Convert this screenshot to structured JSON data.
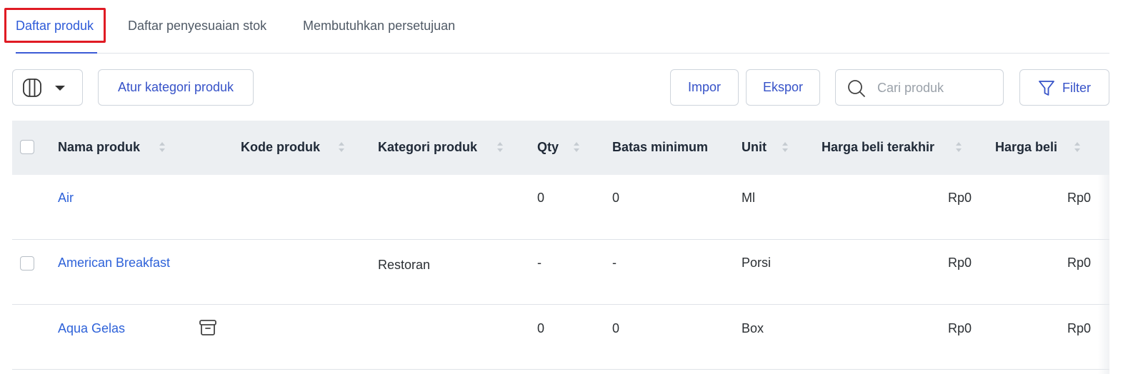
{
  "tabs": [
    {
      "label": "Daftar produk",
      "active": true
    },
    {
      "label": "Daftar penyesuaian stok",
      "active": false
    },
    {
      "label": "Membutuhkan persetujuan",
      "active": false
    }
  ],
  "toolbar": {
    "column_toggle_icon": "columns-icon",
    "dropdown_icon": "caret-down-icon",
    "category_button": "Atur kategori produk",
    "import_button": "Impor",
    "export_button": "Ekspor",
    "search_placeholder": "Cari produk",
    "search_icon": "search-icon",
    "filter_button": "Filter",
    "filter_icon": "funnel-icon"
  },
  "table": {
    "columns": [
      "Nama produk",
      "Kode produk",
      "Kategori produk",
      "Qty",
      "Batas minimum",
      "Unit",
      "Harga beli terakhir",
      "Harga beli"
    ],
    "rows": [
      {
        "name": "Air",
        "code": "",
        "category": "",
        "qty": "0",
        "min": "0",
        "unit": "Ml",
        "last_price": "Rp0",
        "price": "Rp0",
        "checkbox": false,
        "archived": false
      },
      {
        "name": "American Breakfast",
        "code": "",
        "category": "Restoran",
        "qty": "-",
        "min": "-",
        "unit": "Porsi",
        "last_price": "Rp0",
        "price": "Rp0",
        "checkbox": true,
        "archived": false
      },
      {
        "name": "Aqua Gelas",
        "code": "",
        "category": "",
        "qty": "0",
        "min": "0",
        "unit": "Box",
        "last_price": "Rp0",
        "price": "Rp0",
        "checkbox": false,
        "archived": true
      }
    ]
  },
  "colors": {
    "accent": "#2e5bd8",
    "highlight": "#e01b24",
    "header_bg": "#eceff2"
  }
}
